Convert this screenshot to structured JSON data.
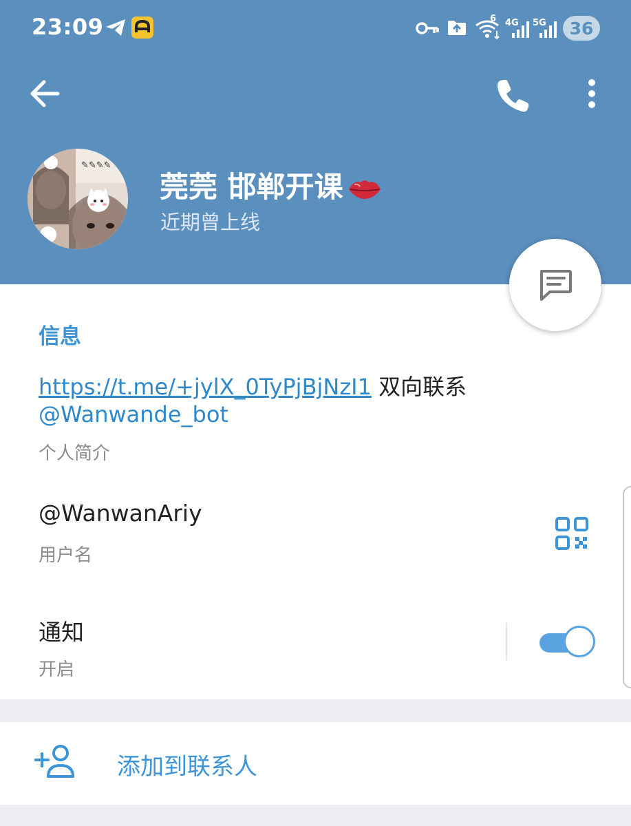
{
  "status_bar": {
    "time": "23:09",
    "wifi_badge": "6",
    "signal_4g": "4G",
    "signal_5g": "5G",
    "battery": "36",
    "icons": [
      "telegram-icon",
      "yellow-app-icon",
      "vpn-key-icon",
      "upload-icon",
      "wifi-icon",
      "signal-icon"
    ]
  },
  "toolbar": {
    "back_icon": "arrow-left-icon",
    "call_icon": "phone-icon",
    "more_icon": "more-vertical-icon"
  },
  "profile": {
    "name": "莞莞 邯郸开课",
    "status": "近期曾上线"
  },
  "info": {
    "section_title": "信息",
    "bio_link": "https://t.me/+jylX_0TyPjBjNzI1",
    "bio_text": " 双向联系",
    "bio_bot": "@Wanwande_bot",
    "bio_label": "个人简介",
    "username": "@WanwanAriy",
    "username_label": "用户名",
    "notifications_title": "通知",
    "notifications_state": "开启",
    "notifications_on": true
  },
  "actions": {
    "add_contact": "添加到联系人"
  },
  "colors": {
    "header": "#5b8fbd",
    "accent": "#3d94d6",
    "link": "#2f88c9",
    "toggle": "#5aa2e0"
  }
}
